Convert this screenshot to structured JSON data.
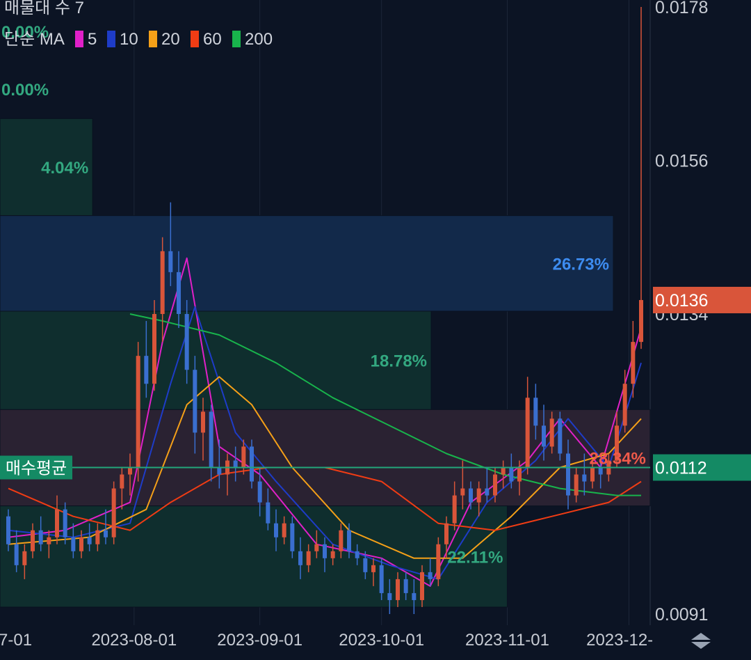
{
  "legend": {
    "title": "매물대 수 7",
    "ma_label": "단순 MA",
    "ma_items": [
      {
        "label": "5",
        "color": "#e020c8"
      },
      {
        "label": "10",
        "color": "#1e3cc8"
      },
      {
        "label": "20",
        "color": "#f5a018"
      },
      {
        "label": "60",
        "color": "#f03c14"
      },
      {
        "label": "200",
        "color": "#18b44c"
      }
    ]
  },
  "colors": {
    "background": "#0c1424",
    "up": "#d9553a",
    "down": "#3a6fd0",
    "avg_line": "#22a77a",
    "current_price_bg": "#d9553a",
    "avg_price_bg": "#148a64",
    "zone_green": "#0f2e2e",
    "zone_blue": "#12294a",
    "zone_red": "#2a2232",
    "zone_label_green": "#33a880",
    "zone_label_blue": "#3d8cf0",
    "zone_label_red": "#f05a4a",
    "axis_text": "#c8ccd4"
  },
  "avg_price": {
    "label": "매수평균",
    "value": "0.0112"
  },
  "current_price": {
    "value": "0.0136"
  },
  "chart_data": {
    "type": "candlestick",
    "symbol_info": "매물대 수 7",
    "x_tick_labels": [
      "7-01",
      "2023-08-01",
      "2023-09-01",
      "2023-10-01",
      "2023-11-01",
      "2023-12-01"
    ],
    "x_range": [
      "2023-07-01",
      "2023-12-05"
    ],
    "y_tick_labels": [
      "0.0178",
      "0.0156",
      "0.0134",
      "0.0112",
      "0.0091"
    ],
    "y_range": [
      0.009,
      0.0179
    ],
    "volume_profile": [
      {
        "label": "0.00%",
        "low": 0.01705,
        "high": 0.01785,
        "width_frac": 0.0
      },
      {
        "label": "0.00%",
        "low": 0.0162,
        "high": 0.01705,
        "width_frac": 0.0
      },
      {
        "label": "4.04%",
        "low": 0.01481,
        "high": 0.0162,
        "width_frac": 0.151
      },
      {
        "label": "26.73%",
        "low": 0.01344,
        "high": 0.01481,
        "width_frac": 1.0
      },
      {
        "label": "18.78%",
        "low": 0.01203,
        "high": 0.01344,
        "width_frac": 0.703
      },
      {
        "label": "28.34%",
        "low": 0.01065,
        "high": 0.01203,
        "width_frac": 1.06
      },
      {
        "label": "22.11%",
        "low": 0.0092,
        "high": 0.01065,
        "width_frac": 0.827
      }
    ],
    "ohlc": [
      [
        "2023-07-01",
        0.0105,
        0.0106,
        0.01,
        0.0101
      ],
      [
        "2023-07-03",
        0.0101,
        0.0103,
        0.0097,
        0.0098
      ],
      [
        "2023-07-05",
        0.0098,
        0.0101,
        0.0096,
        0.01
      ],
      [
        "2023-07-07",
        0.01,
        0.0104,
        0.0099,
        0.0103
      ],
      [
        "2023-07-09",
        0.0103,
        0.0105,
        0.01,
        0.0101
      ],
      [
        "2023-07-11",
        0.0101,
        0.0103,
        0.0099,
        0.0102
      ],
      [
        "2023-07-13",
        0.0102,
        0.0108,
        0.0101,
        0.0106
      ],
      [
        "2023-07-15",
        0.0106,
        0.0107,
        0.0101,
        0.0102
      ],
      [
        "2023-07-17",
        0.0102,
        0.0104,
        0.0099,
        0.01
      ],
      [
        "2023-07-19",
        0.01,
        0.0103,
        0.0099,
        0.0102
      ],
      [
        "2023-07-21",
        0.0102,
        0.0104,
        0.01,
        0.0101
      ],
      [
        "2023-07-23",
        0.0101,
        0.0104,
        0.01,
        0.0103
      ],
      [
        "2023-07-25",
        0.0103,
        0.0106,
        0.0101,
        0.0102
      ],
      [
        "2023-07-27",
        0.0102,
        0.011,
        0.0101,
        0.0109
      ],
      [
        "2023-07-29",
        0.0109,
        0.0112,
        0.0106,
        0.0111
      ],
      [
        "2023-07-31",
        0.0111,
        0.0114,
        0.0108,
        0.0112
      ],
      [
        "2023-08-02",
        0.0112,
        0.013,
        0.011,
        0.0128
      ],
      [
        "2023-08-04",
        0.0128,
        0.0133,
        0.0122,
        0.0124
      ],
      [
        "2023-08-06",
        0.0124,
        0.0136,
        0.0123,
        0.0134
      ],
      [
        "2023-08-08",
        0.0134,
        0.0145,
        0.013,
        0.0143
      ],
      [
        "2023-08-10",
        0.0143,
        0.015,
        0.0138,
        0.014
      ],
      [
        "2023-08-12",
        0.014,
        0.0143,
        0.0132,
        0.0134
      ],
      [
        "2023-08-14",
        0.0134,
        0.0136,
        0.0124,
        0.0126
      ],
      [
        "2023-08-16",
        0.0126,
        0.0128,
        0.0114,
        0.0117
      ],
      [
        "2023-08-18",
        0.0117,
        0.0122,
        0.0113,
        0.012
      ],
      [
        "2023-08-20",
        0.012,
        0.0121,
        0.011,
        0.0112
      ],
      [
        "2023-08-22",
        0.0112,
        0.0116,
        0.0109,
        0.0111
      ],
      [
        "2023-08-24",
        0.0111,
        0.0114,
        0.0108,
        0.0113
      ],
      [
        "2023-08-26",
        0.0113,
        0.0115,
        0.011,
        0.0112
      ],
      [
        "2023-08-28",
        0.0112,
        0.0116,
        0.0111,
        0.0115
      ],
      [
        "2023-08-30",
        0.0115,
        0.0116,
        0.0109,
        0.011
      ],
      [
        "2023-09-01",
        0.011,
        0.0112,
        0.0105,
        0.0107
      ],
      [
        "2023-09-03",
        0.0107,
        0.0109,
        0.0103,
        0.0104
      ],
      [
        "2023-09-05",
        0.0104,
        0.0106,
        0.01,
        0.0102
      ],
      [
        "2023-09-07",
        0.0102,
        0.0105,
        0.0101,
        0.0104
      ],
      [
        "2023-09-09",
        0.0104,
        0.0105,
        0.0099,
        0.01
      ],
      [
        "2023-09-11",
        0.01,
        0.0102,
        0.0096,
        0.0098
      ],
      [
        "2023-09-13",
        0.0098,
        0.0101,
        0.0097,
        0.01
      ],
      [
        "2023-09-15",
        0.01,
        0.0103,
        0.0099,
        0.0101
      ],
      [
        "2023-09-17",
        0.0101,
        0.0102,
        0.0097,
        0.0099
      ],
      [
        "2023-09-19",
        0.0099,
        0.0101,
        0.0098,
        0.01
      ],
      [
        "2023-09-21",
        0.01,
        0.0104,
        0.0099,
        0.0103
      ],
      [
        "2023-09-23",
        0.0103,
        0.0104,
        0.0099,
        0.01
      ],
      [
        "2023-09-25",
        0.01,
        0.0101,
        0.0098,
        0.0099
      ],
      [
        "2023-09-27",
        0.0099,
        0.01,
        0.0096,
        0.0097
      ],
      [
        "2023-09-29",
        0.0097,
        0.0099,
        0.0095,
        0.0098
      ],
      [
        "2023-10-01",
        0.0098,
        0.0099,
        0.0093,
        0.0094
      ],
      [
        "2023-10-03",
        0.0094,
        0.0096,
        0.0091,
        0.0093
      ],
      [
        "2023-10-05",
        0.0093,
        0.0097,
        0.0092,
        0.0096
      ],
      [
        "2023-10-07",
        0.0096,
        0.0097,
        0.0093,
        0.0094
      ],
      [
        "2023-10-09",
        0.0094,
        0.0096,
        0.0091,
        0.0093
      ],
      [
        "2023-10-11",
        0.0093,
        0.0098,
        0.0092,
        0.0097
      ],
      [
        "2023-10-13",
        0.0097,
        0.0099,
        0.0095,
        0.0096
      ],
      [
        "2023-10-15",
        0.0096,
        0.0102,
        0.0095,
        0.0101
      ],
      [
        "2023-10-17",
        0.0101,
        0.0105,
        0.0099,
        0.0104
      ],
      [
        "2023-10-19",
        0.0104,
        0.011,
        0.0103,
        0.0108
      ],
      [
        "2023-10-21",
        0.0108,
        0.0113,
        0.0106,
        0.0109
      ],
      [
        "2023-10-23",
        0.0109,
        0.011,
        0.0106,
        0.0107
      ],
      [
        "2023-10-25",
        0.0107,
        0.011,
        0.0105,
        0.0109
      ],
      [
        "2023-10-27",
        0.0109,
        0.0112,
        0.0107,
        0.0108
      ],
      [
        "2023-10-29",
        0.0108,
        0.0112,
        0.0107,
        0.0111
      ],
      [
        "2023-10-31",
        0.0111,
        0.0113,
        0.0109,
        0.0112
      ],
      [
        "2023-11-02",
        0.0112,
        0.0114,
        0.0109,
        0.011
      ],
      [
        "2023-11-04",
        0.011,
        0.0113,
        0.0108,
        0.0112
      ],
      [
        "2023-11-06",
        0.0112,
        0.0125,
        0.0111,
        0.0122
      ],
      [
        "2023-11-08",
        0.0122,
        0.0124,
        0.0116,
        0.0118
      ],
      [
        "2023-11-10",
        0.0118,
        0.0121,
        0.0113,
        0.0115
      ],
      [
        "2023-11-12",
        0.0115,
        0.012,
        0.0114,
        0.0119
      ],
      [
        "2023-11-14",
        0.0119,
        0.012,
        0.0113,
        0.0114
      ],
      [
        "2023-11-16",
        0.0114,
        0.0116,
        0.0106,
        0.0108
      ],
      [
        "2023-11-18",
        0.0108,
        0.0112,
        0.0107,
        0.0111
      ],
      [
        "2023-11-20",
        0.0111,
        0.0114,
        0.0108,
        0.011
      ],
      [
        "2023-11-22",
        0.011,
        0.0113,
        0.0109,
        0.0112
      ],
      [
        "2023-11-24",
        0.0112,
        0.0113,
        0.0109,
        0.0111
      ],
      [
        "2023-11-26",
        0.0111,
        0.0114,
        0.011,
        0.0113
      ],
      [
        "2023-11-28",
        0.0113,
        0.012,
        0.0112,
        0.0118
      ],
      [
        "2023-11-30",
        0.0118,
        0.0126,
        0.0117,
        0.0124
      ],
      [
        "2023-12-02",
        0.0124,
        0.0133,
        0.0122,
        0.013
      ],
      [
        "2023-12-04",
        0.013,
        0.0178,
        0.0129,
        0.0136
      ]
    ],
    "moving_averages": [
      {
        "name": "5",
        "color": "#e020c8",
        "x": [
          "2023-07-01",
          "2023-07-15",
          "2023-07-31",
          "2023-08-08",
          "2023-08-14",
          "2023-08-22",
          "2023-09-01",
          "2023-09-15",
          "2023-10-01",
          "2023-10-13",
          "2023-10-23",
          "2023-11-06",
          "2023-11-14",
          "2023-11-24",
          "2023-12-04"
        ],
        "y": [
          0.0102,
          0.0103,
          0.0107,
          0.013,
          0.0142,
          0.0115,
          0.0111,
          0.0101,
          0.0099,
          0.0095,
          0.0107,
          0.0113,
          0.0119,
          0.0112,
          0.0132
        ]
      },
      {
        "name": "10",
        "color": "#1e3cc8",
        "x": [
          "2023-07-01",
          "2023-07-17",
          "2023-07-31",
          "2023-08-10",
          "2023-08-16",
          "2023-08-26",
          "2023-09-05",
          "2023-09-19",
          "2023-10-03",
          "2023-10-15",
          "2023-10-27",
          "2023-11-08",
          "2023-11-16",
          "2023-11-26",
          "2023-12-04"
        ],
        "y": [
          0.0103,
          0.0102,
          0.0104,
          0.0124,
          0.0135,
          0.0117,
          0.011,
          0.0101,
          0.0098,
          0.0096,
          0.0107,
          0.0113,
          0.0119,
          0.0112,
          0.0127
        ]
      },
      {
        "name": "20",
        "color": "#f5a018",
        "x": [
          "2023-07-01",
          "2023-07-21",
          "2023-08-04",
          "2023-08-14",
          "2023-08-22",
          "2023-08-30",
          "2023-09-09",
          "2023-09-23",
          "2023-10-09",
          "2023-10-21",
          "2023-11-02",
          "2023-11-14",
          "2023-11-26",
          "2023-12-04"
        ],
        "y": [
          0.0101,
          0.0102,
          0.0106,
          0.0121,
          0.0125,
          0.0121,
          0.0112,
          0.0103,
          0.0099,
          0.0099,
          0.0105,
          0.0112,
          0.0114,
          0.0119
        ]
      },
      {
        "name": "60",
        "color": "#f03c14",
        "x": [
          "2023-07-01",
          "2023-07-17",
          "2023-07-31",
          "2023-08-10",
          "2023-08-22",
          "2023-09-03",
          "2023-09-17",
          "2023-10-01",
          "2023-10-15",
          "2023-10-29",
          "2023-11-12",
          "2023-11-26",
          "2023-12-04"
        ],
        "y": [
          0.0109,
          0.0105,
          0.0103,
          0.0107,
          0.0111,
          0.0112,
          0.0112,
          0.011,
          0.0104,
          0.0103,
          0.0105,
          0.0107,
          0.011
        ]
      },
      {
        "name": "200",
        "color": "#18b44c",
        "x": [
          "2023-07-31",
          "2023-08-08",
          "2023-08-22",
          "2023-09-05",
          "2023-09-19",
          "2023-10-03",
          "2023-10-17",
          "2023-10-31",
          "2023-11-14",
          "2023-11-28",
          "2023-12-04"
        ],
        "y": [
          0.0134,
          0.0133,
          0.0131,
          0.0127,
          0.0122,
          0.0118,
          0.0114,
          0.0111,
          0.0109,
          0.0108,
          0.0108
        ]
      }
    ]
  }
}
